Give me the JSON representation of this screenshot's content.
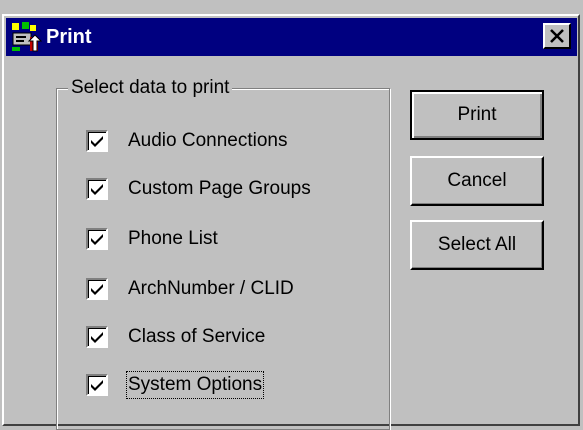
{
  "window": {
    "title": "Print",
    "icon": "print-app-icon",
    "close_icon": "close-icon"
  },
  "group": {
    "legend": "Select data to print",
    "items": [
      {
        "label": "Audio Connections",
        "checked": true
      },
      {
        "label": "Custom Page Groups",
        "checked": true
      },
      {
        "label": "Phone List",
        "checked": true
      },
      {
        "label": "ArchNumber / CLID",
        "checked": true
      },
      {
        "label": "Class of Service",
        "checked": true
      },
      {
        "label": "System Options",
        "checked": true,
        "focused": true
      }
    ]
  },
  "buttons": {
    "print": "Print",
    "cancel": "Cancel",
    "select_all": "Select All"
  },
  "colors": {
    "titlebar": "#000080",
    "face": "#c0c0c0"
  }
}
